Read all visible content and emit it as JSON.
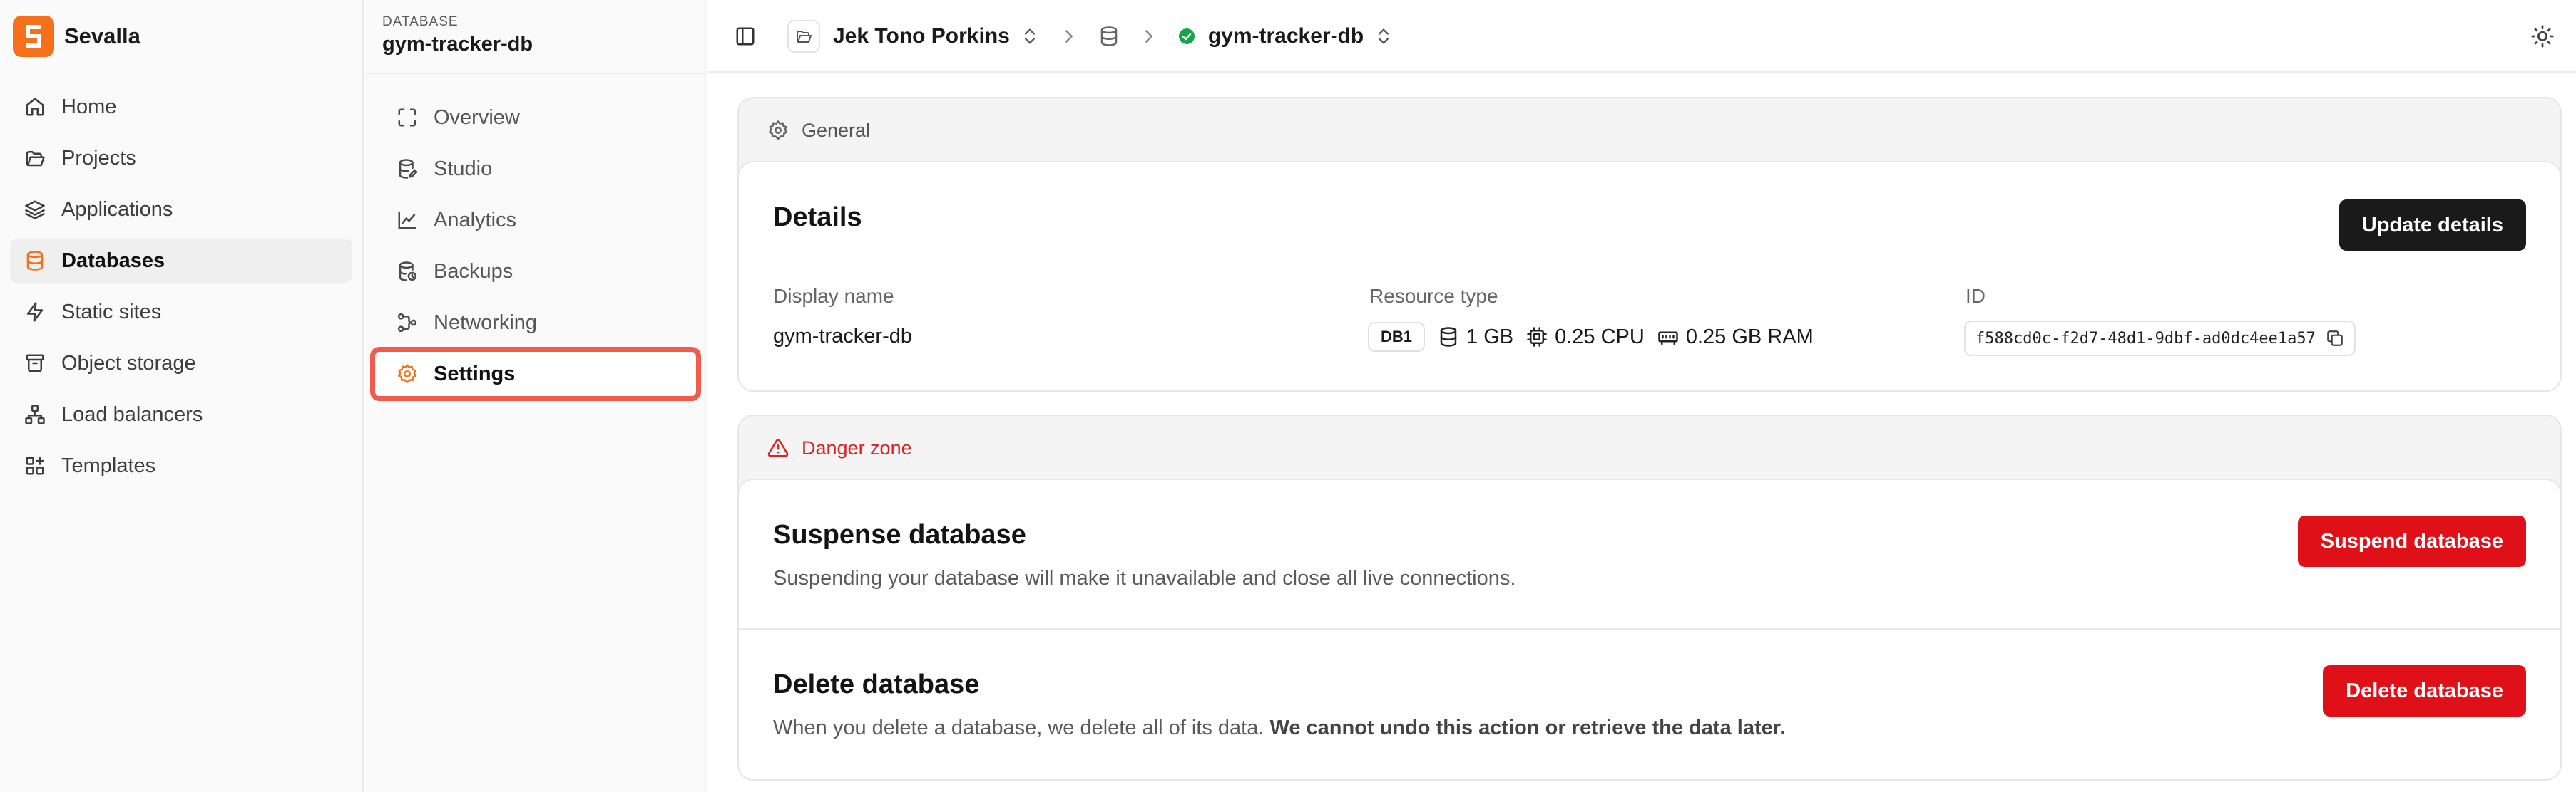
{
  "brand": {
    "name": "Sevalla",
    "logo_icon": "sevalla-logo-icon",
    "accent": "#f5701a"
  },
  "sidebar": {
    "items": [
      {
        "label": "Home",
        "icon": "home-icon",
        "active": false
      },
      {
        "label": "Projects",
        "icon": "folder-icon",
        "active": false
      },
      {
        "label": "Applications",
        "icon": "layers-icon",
        "active": false
      },
      {
        "label": "Databases",
        "icon": "database-icon",
        "active": true
      },
      {
        "label": "Static sites",
        "icon": "bolt-icon",
        "active": false
      },
      {
        "label": "Object storage",
        "icon": "archive-icon",
        "active": false
      },
      {
        "label": "Load balancers",
        "icon": "network-icon",
        "active": false
      },
      {
        "label": "Templates",
        "icon": "grid-plus-icon",
        "active": false
      }
    ]
  },
  "subsidebar": {
    "kicker": "DATABASE",
    "title": "gym-tracker-db",
    "items": [
      {
        "label": "Overview",
        "icon": "expand-icon",
        "active": false
      },
      {
        "label": "Studio",
        "icon": "database-edit-icon",
        "active": false
      },
      {
        "label": "Analytics",
        "icon": "chart-line-icon",
        "active": false
      },
      {
        "label": "Backups",
        "icon": "database-backup-icon",
        "active": false
      },
      {
        "label": "Networking",
        "icon": "workflow-icon",
        "active": false
      },
      {
        "label": "Settings",
        "icon": "gear-icon",
        "active": true
      }
    ],
    "highlight_color": "#ef5b4d"
  },
  "topbar": {
    "project": "Jek Tono Porkins",
    "database": "gym-tracker-db",
    "status_color": "#16a34a"
  },
  "general": {
    "section_title": "General",
    "details_title": "Details",
    "update_button": "Update details",
    "display_name_label": "Display name",
    "display_name": "gym-tracker-db",
    "resource_type_label": "Resource type",
    "resource": {
      "tier": "DB1",
      "storage": "1 GB",
      "cpu": "0.25 CPU",
      "ram": "0.25 GB RAM"
    },
    "id_label": "ID",
    "id_value": "f588cd0c-f2d7-48d1-9dbf-ad0dc4ee1a57"
  },
  "danger": {
    "section_title": "Danger zone",
    "accent": "#e01018",
    "suspend": {
      "title": "Suspense database",
      "description": "Suspending your database will make it unavailable and close all live connections.",
      "button": "Suspend database"
    },
    "delete": {
      "title": "Delete database",
      "description": "When you delete a database, we delete all of its data.",
      "description_bold": "We cannot undo this action or retrieve the data later.",
      "button": "Delete database"
    }
  }
}
